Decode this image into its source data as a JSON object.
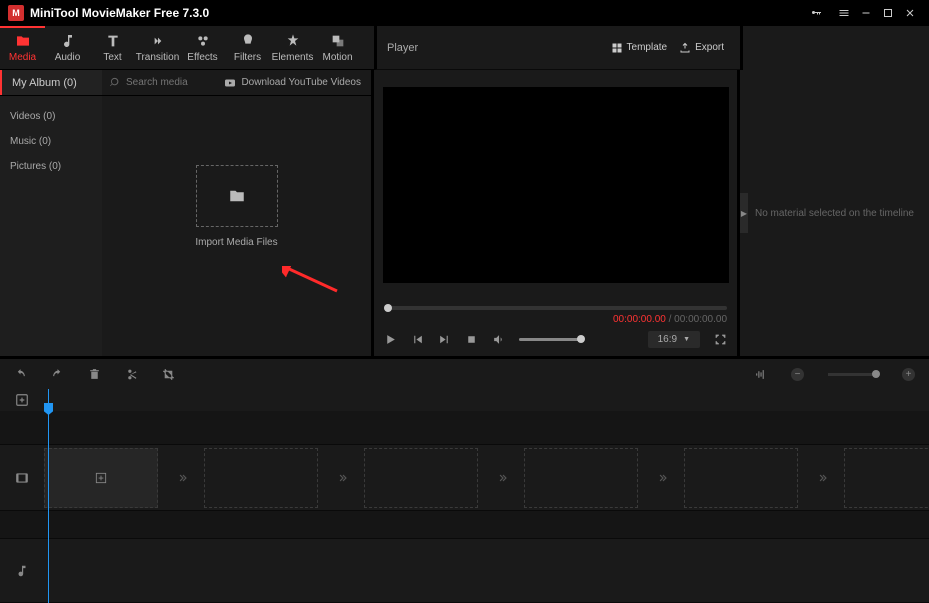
{
  "app": {
    "title": "MiniTool MovieMaker Free 7.3.0"
  },
  "toolbar": {
    "tabs": [
      {
        "label": "Media"
      },
      {
        "label": "Audio"
      },
      {
        "label": "Text"
      },
      {
        "label": "Transition"
      },
      {
        "label": "Effects"
      },
      {
        "label": "Filters"
      },
      {
        "label": "Elements"
      },
      {
        "label": "Motion"
      }
    ]
  },
  "media": {
    "album_label": "My Album (0)",
    "search_placeholder": "Search media",
    "yt_label": "Download YouTube Videos",
    "sidebar": [
      {
        "label": "Videos (0)"
      },
      {
        "label": "Music (0)"
      },
      {
        "label": "Pictures (0)"
      }
    ],
    "import_label": "Import Media Files"
  },
  "player": {
    "title": "Player",
    "template_label": "Template",
    "export_label": "Export",
    "time_current": "00:00:00.00",
    "time_total": "00:00:00.00",
    "aspect": "16:9"
  },
  "props": {
    "empty_msg": "No material selected on the timeline"
  }
}
